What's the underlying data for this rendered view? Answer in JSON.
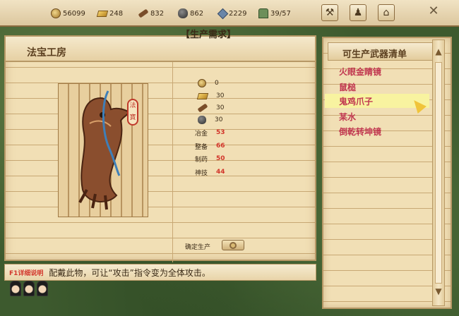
{
  "topbar": {
    "resources": [
      {
        "icon": "coin-icon",
        "value": "56099"
      },
      {
        "icon": "gold-bar-icon",
        "value": "248"
      },
      {
        "icon": "wood-icon",
        "value": "832"
      },
      {
        "icon": "ore-icon",
        "value": "862"
      },
      {
        "icon": "gem-icon",
        "value": "2229"
      },
      {
        "icon": "population-icon",
        "value": "39/57"
      }
    ]
  },
  "workshop": {
    "title": "法宝工房",
    "requirements_heading": "【生产需求】",
    "materials": [
      {
        "icon": "coin-icon",
        "value": "0"
      },
      {
        "icon": "gold-bar-icon",
        "value": "30"
      },
      {
        "icon": "wood-icon",
        "value": "30"
      },
      {
        "icon": "ore-icon",
        "value": "30"
      }
    ],
    "skills": [
      {
        "label": "冶金",
        "value": "53"
      },
      {
        "label": "整备",
        "value": "66"
      },
      {
        "label": "制药",
        "value": "50"
      },
      {
        "label": "神技",
        "value": "44"
      }
    ],
    "seal_text": "法寶",
    "confirm_label": "确定生产"
  },
  "info": {
    "hotkey": "F1详细说明",
    "description": "配戴此物，可让“攻击”指令变为全体攻击。"
  },
  "weapon_list": {
    "title": "可生产武器清单",
    "items": [
      "火眼金睛镜",
      "鼠槌",
      "鬼鸡爪子",
      "某水",
      "倒乾转坤镜"
    ],
    "selected": "鬼鸡爪子"
  },
  "colors": {
    "accent_text": "#c0364f",
    "skill_value": "#d2352a",
    "selected_row": "#f8f3a0"
  }
}
